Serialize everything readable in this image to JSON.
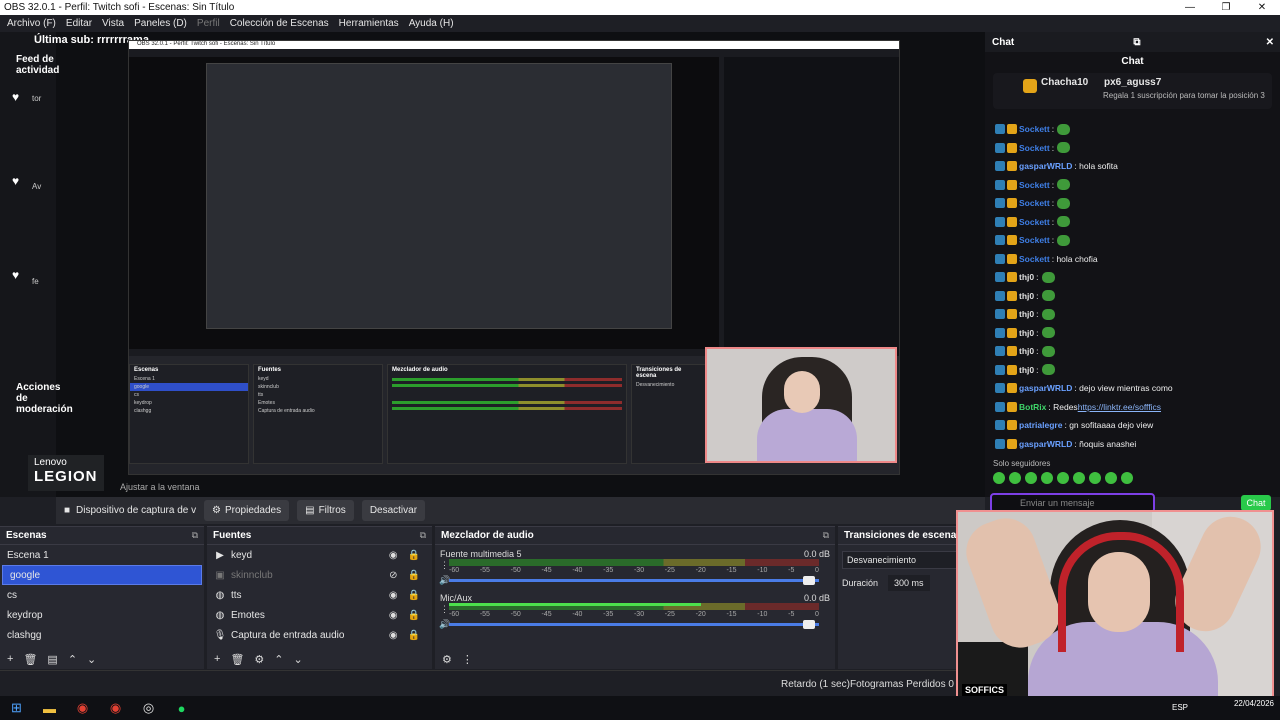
{
  "window": {
    "title": "OBS 32.0.1 - Perfil: Twitch sofi - Escenas: Sin Título",
    "minimize": "—",
    "maximize": "❐",
    "close": "✕"
  },
  "menu": {
    "file": "Archivo (F)",
    "edit": "Editar",
    "view": "Vista",
    "docks": "Paneles (D)",
    "profile": "Perfil",
    "scene_collection": "Colección de Escenas",
    "tools": "Herramientas",
    "help": "Ayuda (H)"
  },
  "preview": {
    "last_sub": "Última sub: rrrrrrrama",
    "activity_feed": "Feed de actividad",
    "actions": "Acciones de moderación",
    "feed_items": [
      "tor",
      "Av",
      "fe"
    ],
    "lenovo": "Lenovo",
    "legion": "LEGION",
    "fit": "Ajustar a la ventana"
  },
  "props_bar": {
    "source": "Dispositivo de captura de v",
    "properties": "Propiedades",
    "filters": "Filtros",
    "deactivate": "Desactivar"
  },
  "scenes": {
    "title": "Escenas",
    "items": [
      "Escena 1",
      "google",
      "cs",
      "keydrop",
      "clashgg"
    ],
    "selected_index": 1
  },
  "sources": {
    "title": "Fuentes",
    "items": [
      {
        "name": "keyd",
        "icon": "play-icon"
      },
      {
        "name": "skinnclub",
        "icon": "image-icon"
      },
      {
        "name": "tts",
        "icon": "globe-icon"
      },
      {
        "name": "Emotes",
        "icon": "globe-icon"
      },
      {
        "name": "Captura de entrada audio",
        "icon": "mic-icon"
      }
    ]
  },
  "mixer": {
    "title": "Mezclador de audio",
    "channels": [
      {
        "name": "Fuente multimedia 5",
        "db": "0.0 dB",
        "level": 0.0
      },
      {
        "name": "Mic/Aux",
        "db": "0.0 dB",
        "level": 0.68
      }
    ],
    "ticks": [
      "-60",
      "-55",
      "-50",
      "-45",
      "-40",
      "-35",
      "-30",
      "-25",
      "-20",
      "-15",
      "-10",
      "-5",
      "0"
    ]
  },
  "transitions": {
    "title": "Transiciones de escena",
    "type": "Desvanecimiento",
    "duration_label": "Duración",
    "duration_value": "300 ms"
  },
  "status": {
    "delay": "Retardo (1 sec)",
    "dropped": "Fotogramas Perdidos 0 (0.0"
  },
  "chat": {
    "dock_title": "Chat",
    "title": "Chat",
    "pinned_user1": "Chacha10",
    "pinned_count": "1",
    "pinned_user2": "px6_aguss7",
    "pinned_msg": "Regala 1 suscripción para tomar la posición 3",
    "messages": [
      {
        "user": "Sockett",
        "text": ":",
        "color": "#3f7fe6"
      },
      {
        "user": "Sockett",
        "text": ":",
        "color": "#3f7fe6"
      },
      {
        "user": "gasparWRLD",
        "text": ": hola sofita",
        "color": "#6aa0ff"
      },
      {
        "user": "Sockett",
        "text": ":",
        "color": "#3f7fe6"
      },
      {
        "user": "Sockett",
        "text": ":",
        "color": "#3f7fe6"
      },
      {
        "user": "Sockett",
        "text": ":",
        "color": "#3f7fe6"
      },
      {
        "user": "Sockett",
        "text": ":",
        "color": "#3f7fe6"
      },
      {
        "user": "Sockett",
        "text": ": hola chofia",
        "color": "#3f7fe6"
      },
      {
        "user": "thj0",
        "text": ":",
        "color": "#e0e0e0"
      },
      {
        "user": "thj0",
        "text": ":",
        "color": "#e0e0e0"
      },
      {
        "user": "thj0",
        "text": ":",
        "color": "#e0e0e0"
      },
      {
        "user": "thj0",
        "text": ":",
        "color": "#e0e0e0"
      },
      {
        "user": "thj0",
        "text": ":",
        "color": "#e0e0e0"
      },
      {
        "user": "thj0",
        "text": ":",
        "color": "#e0e0e0"
      },
      {
        "user": "gasparWRLD",
        "text": ": dejo view mientras como",
        "color": "#6aa0ff"
      },
      {
        "user": "BotRix",
        "text": ": Redes ",
        "link": "https://linktr.ee/sofffics",
        "color": "#3fd46a"
      },
      {
        "user": "patrialegre",
        "text": ": gn sofitaaaa dejo view",
        "color": "#6aa0ff"
      },
      {
        "user": "gasparWRLD",
        "text": ": ñoquis anashei",
        "color": "#6aa0ff"
      }
    ],
    "subs_only": "Solo seguidores",
    "input_placeholder": "Enviar un mensaje",
    "send": "Chat"
  },
  "webcam": {
    "tag": "SOFFICS"
  },
  "taskbar": {
    "lang": "ESP",
    "date": "22/04/2026"
  }
}
